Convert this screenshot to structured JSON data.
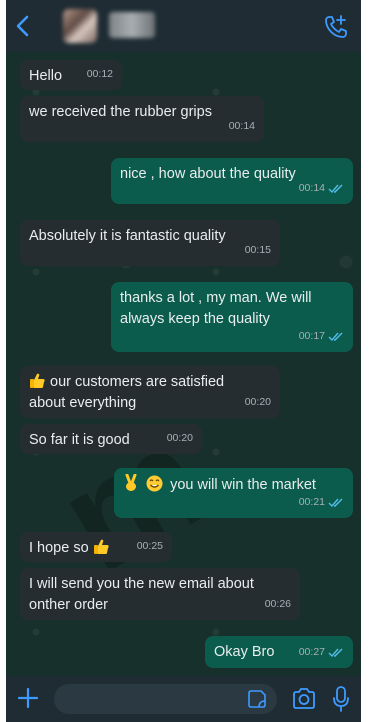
{
  "messages": [
    {
      "text": "Hello",
      "time": "00:12",
      "dir": "in"
    },
    {
      "text": "we received the rubber grips",
      "time": "00:14",
      "dir": "in"
    },
    {
      "text": "nice , how about the quality",
      "time": "00:14",
      "dir": "out"
    },
    {
      "text": "Absolutely it is fantastic quality",
      "time": "00:15",
      "dir": "in"
    },
    {
      "line1": "thanks a lot , my man. We will",
      "line2": "always keep the quality",
      "time": "00:17",
      "dir": "out"
    },
    {
      "line1": "our customers are satisfied",
      "line2": "about everything",
      "time": "00:20",
      "dir": "in",
      "emoji": "thumbs-up"
    },
    {
      "text": "So far it is good",
      "time": "00:20",
      "dir": "in"
    },
    {
      "text": "you will win the market",
      "time": "00:21",
      "dir": "out",
      "emoji": [
        "victory-hand",
        "smiling-face"
      ]
    },
    {
      "text": "I hope so",
      "time": "00:25",
      "dir": "in",
      "emoji": "thumbs-up"
    },
    {
      "line1": "I will send you the new email about",
      "line2": "onther order",
      "time": "00:26",
      "dir": "in"
    },
    {
      "text": "Okay Bro",
      "time": "00:27",
      "dir": "out"
    }
  ],
  "colors": {
    "header_bg": "#1f2c33",
    "incoming_bubble": "#262d31",
    "outgoing_bubble": "#0b5c4d",
    "read_check": "#53bdeb",
    "accent_blue": "#3d9bff"
  },
  "icons": {
    "back": "chevron-left-icon",
    "call": "phone-plus-icon",
    "plus": "plus-icon",
    "sticker": "sticker-icon",
    "camera": "camera-icon",
    "mic": "microphone-icon"
  }
}
